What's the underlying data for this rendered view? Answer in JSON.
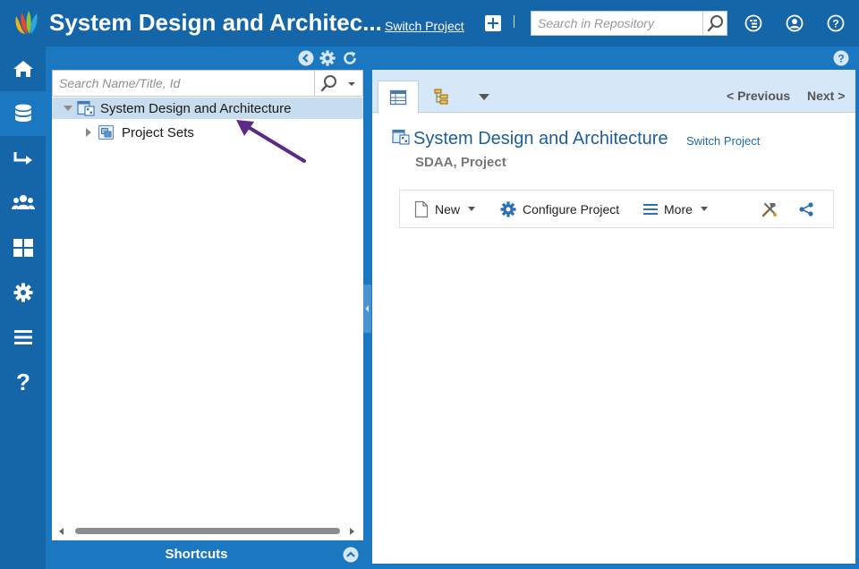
{
  "header": {
    "title": "System Design and Architec...",
    "switch_project": "Switch Project",
    "search_placeholder": "Search in Repository"
  },
  "leftnav": {
    "items": [
      {
        "name": "home-icon",
        "active": false
      },
      {
        "name": "database-icon",
        "active": true
      },
      {
        "name": "arrow-forward-icon",
        "active": false
      },
      {
        "name": "users-icon",
        "active": false
      },
      {
        "name": "dashboard-icon",
        "active": false
      },
      {
        "name": "gear-icon",
        "active": false
      },
      {
        "name": "menu-icon",
        "active": false
      },
      {
        "name": "help-icon",
        "active": false
      }
    ]
  },
  "tree": {
    "search_placeholder": "Search Name/Title, Id",
    "nodes": [
      {
        "label": "System Design and Architecture",
        "expanded": true,
        "selected": true
      },
      {
        "label": "Project Sets",
        "expanded": false,
        "selected": false
      }
    ],
    "shortcuts_label": "Shortcuts"
  },
  "content": {
    "prev_label": "< Previous",
    "next_label": "Next >",
    "project_title": "System Design and Architecture",
    "switch_project": "Switch Project",
    "subtitle": "SDAA, Project",
    "actions": {
      "new_label": "New",
      "configure_label": "Configure Project",
      "more_label": "More"
    }
  },
  "colors": {
    "header_bg": "#1565a9",
    "panel_bg": "#1b77bf",
    "accent": "#1b5f9c",
    "annotation_arrow": "#5b2a86"
  }
}
